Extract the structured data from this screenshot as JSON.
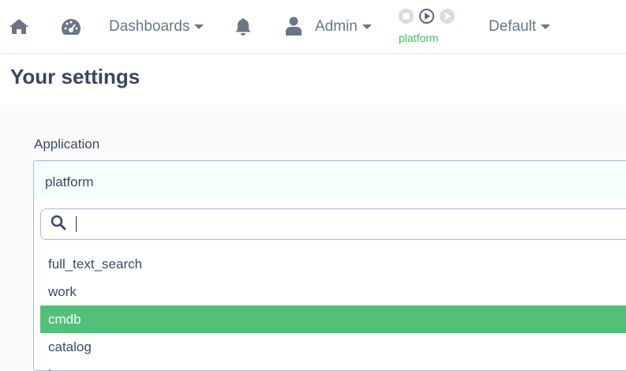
{
  "nav": {
    "home_icon": "home-icon",
    "dashboard_icon": "tachometer-icon",
    "dashboards_label": "Dashboards",
    "bell_icon": "bell-icon",
    "user_icon": "user-icon",
    "admin_label": "Admin",
    "runner": {
      "label": "platform",
      "label_color": "#3ebf62",
      "buttons": [
        "stop-icon",
        "play-circle-icon",
        "play-icon"
      ]
    },
    "default_label": "Default"
  },
  "page": {
    "title": "Your settings"
  },
  "form": {
    "application_label": "Application",
    "application_value": "platform",
    "search_value": "",
    "options": [
      "full_text_search",
      "work",
      "cmdb",
      "catalog",
      "k"
    ],
    "selected_option": "cmdb",
    "selected_color": "#52c078"
  }
}
